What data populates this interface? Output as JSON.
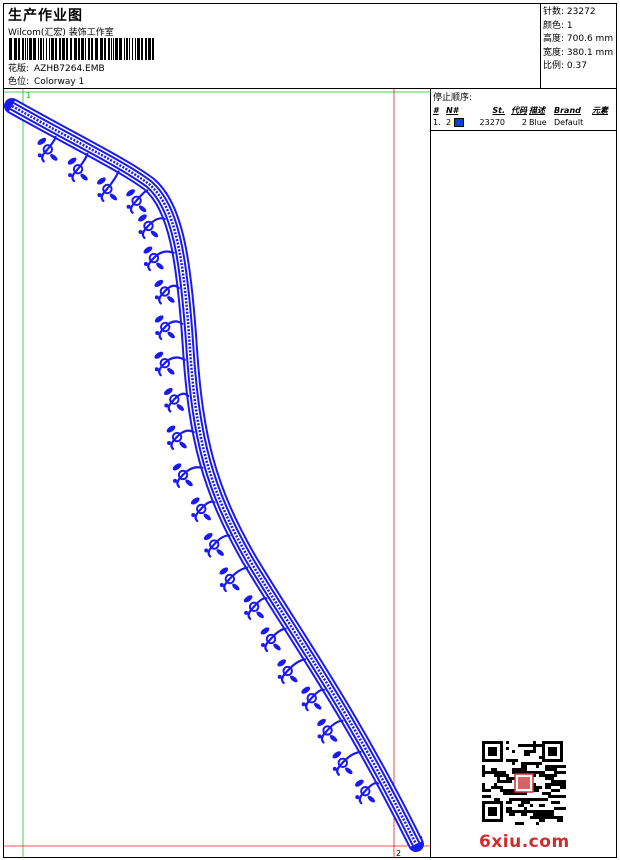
{
  "header": {
    "title": "生产作业图",
    "subtitle": "Wilcom(汇宏) 装饰工作室",
    "design_label": "花版:",
    "design_value": "AZHB7264.EMB",
    "colorway_label": "色位:",
    "colorway_value": "Colorway 1"
  },
  "stats": [
    {
      "label": "针数:",
      "value": "23272"
    },
    {
      "label": "颜色:",
      "value": "1"
    },
    {
      "label": "高度:",
      "value": "700.6 mm"
    },
    {
      "label": "宽度:",
      "value": "380.1 mm"
    },
    {
      "label": "比例:",
      "value": "0.37"
    }
  ],
  "design": {
    "stitch_color": "#1a1af0",
    "guide_green": "#22c022",
    "guide_red": "#e02020",
    "start_marker": "1",
    "end_marker": "2",
    "end_marker_right": "2"
  },
  "stop_panel": {
    "heading": "停止顺序:",
    "columns": [
      "#",
      "N#",
      "St.",
      "代码",
      "描述",
      "Brand",
      "元素"
    ],
    "rows": [
      {
        "num": "1.",
        "n": "2",
        "swatch": "#0a3ee0",
        "st": "23270",
        "code": "2",
        "desc": "Blue",
        "brand": "Default",
        "element": ""
      }
    ]
  },
  "watermark": {
    "text": "6xiu.com",
    "color": "#d12b2b",
    "seal_color": "#c83030"
  }
}
